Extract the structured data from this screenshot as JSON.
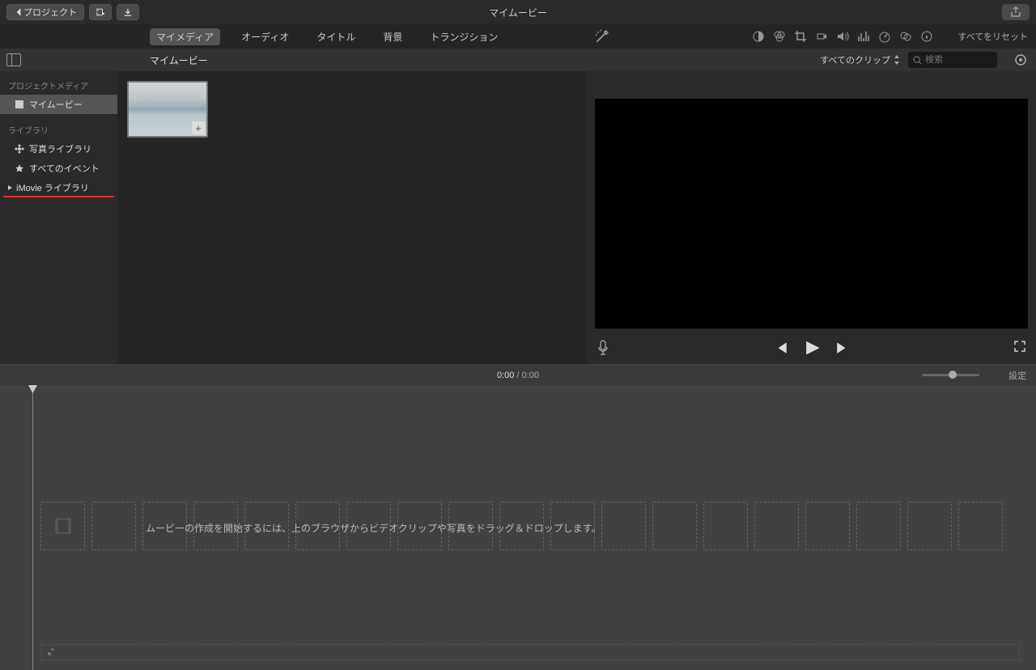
{
  "title": "マイムービー",
  "toolbar": {
    "back_label": "プロジェクト"
  },
  "tabs": [
    "マイメディア",
    "オーディオ",
    "タイトル",
    "背景",
    "トランジション"
  ],
  "tabs_active_index": 0,
  "adjust_reset": "すべてをリセット",
  "secbar": {
    "breadcrumb": "マイムービー",
    "filter_label": "すべてのクリップ",
    "search_placeholder": "検索"
  },
  "sidebar": {
    "section1": "プロジェクトメディア",
    "item_mymovie": "マイムービー",
    "section2": "ライブラリ",
    "item_photolib": "写真ライブラリ",
    "item_allevents": "すべてのイベント",
    "item_imovielib": "iMovie ライブラリ"
  },
  "timebar": {
    "current": "0:00",
    "total": "0:00",
    "settings": "設定"
  },
  "timeline": {
    "drop_hint": "ムービーの作成を開始するには、上のブラウザからビデオクリップや写真をドラッグ＆ドロップします。"
  }
}
